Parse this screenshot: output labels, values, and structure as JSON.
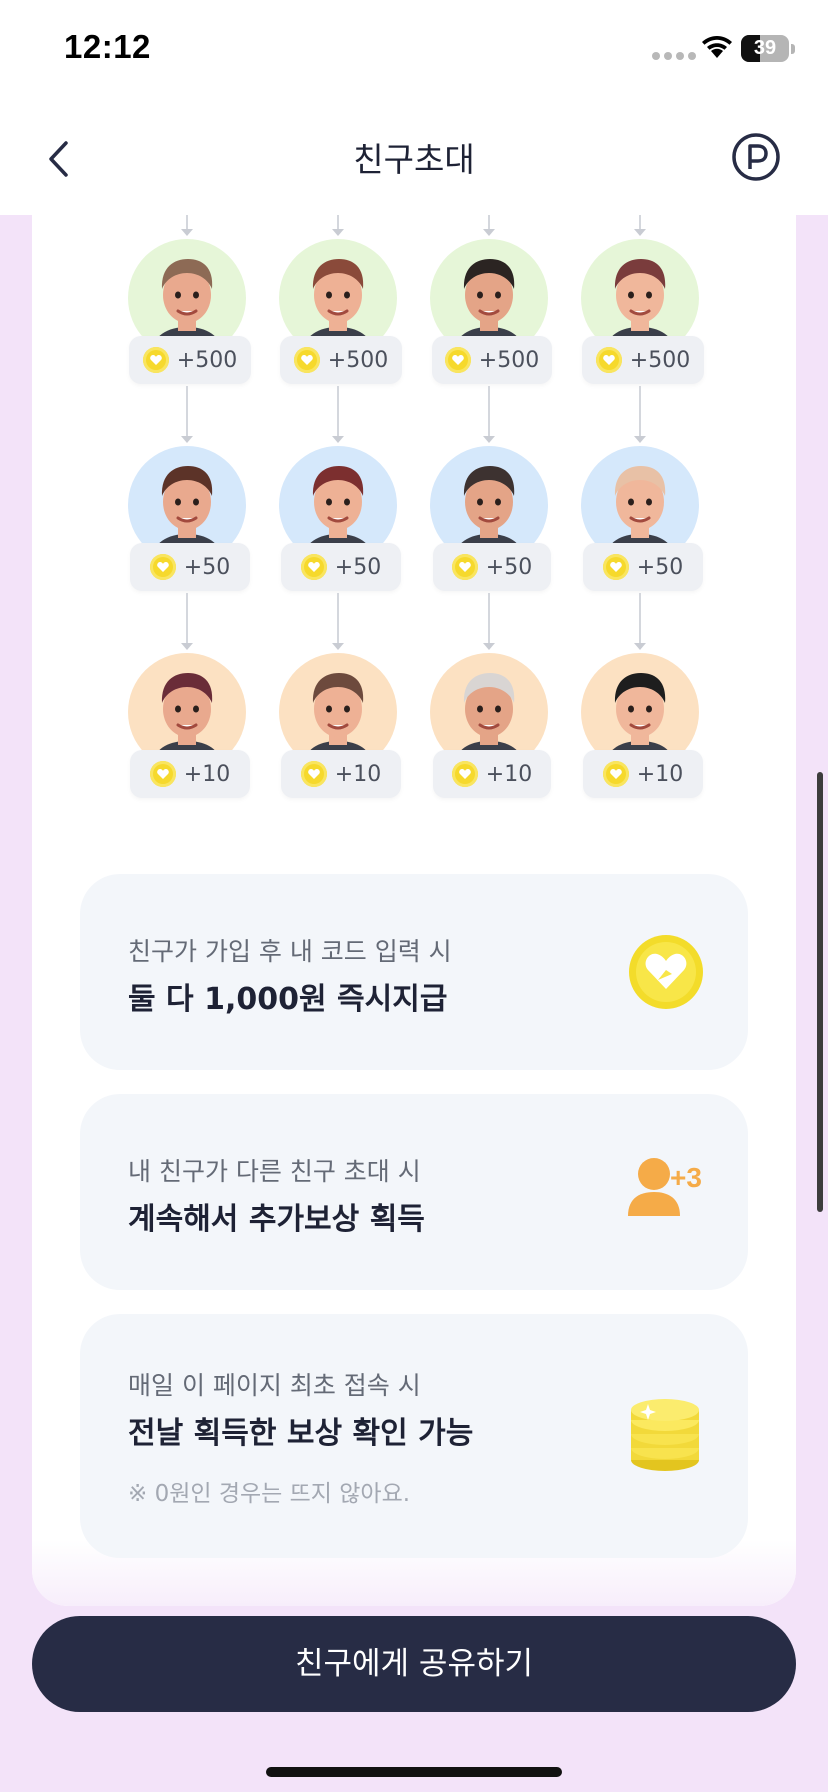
{
  "status_bar": {
    "time": "12:12",
    "battery_percent": 39,
    "battery_text": "39"
  },
  "nav": {
    "title": "친구초대",
    "back_icon": "chevron-left-icon",
    "point_icon": "point-circle-icon"
  },
  "tiers": [
    {
      "level": 1,
      "reward": "+500",
      "background": "#e6f6d8",
      "avatars": [
        "man-short-brown-hair",
        "woman-hair-bun",
        "man-dark-hair-goatee",
        "man-maroon-hair-earring"
      ]
    },
    {
      "level": 2,
      "reward": "+50",
      "background": "#d5e8fb",
      "avatars": [
        "man-long-hair-beard",
        "man-maroon-cap",
        "man-dark-side-part",
        "bald-man-mohawk"
      ]
    },
    {
      "level": 3,
      "reward": "+10",
      "background": "#fce1c2",
      "avatars": [
        "man-beanie-sunglasses",
        "man-glasses-mustache",
        "woman-grey-bun",
        "man-black-cap-beard"
      ]
    }
  ],
  "info_cards": [
    {
      "subtitle": "친구가 가입 후 내 코드 입력 시",
      "title": "둘 다 1,000원 즉시지급",
      "icon": "heart-coin-icon"
    },
    {
      "subtitle": "내 친구가 다른 친구 초대 시",
      "title": "계속해서 추가보상 획득",
      "icon": "user-plus-three-icon",
      "icon_text": "+3"
    },
    {
      "subtitle": "매일 이 페이지 최초 접속 시",
      "title": "전날 획득한 보상 확인 가능",
      "note": "※ 0원인 경우는 뜨지 않아요.",
      "icon": "coin-stack-icon"
    }
  ],
  "share_button": {
    "label": "친구에게 공유하기"
  },
  "colors": {
    "accent": "#272c45",
    "page_bg": "#f3e3f9",
    "coin": "#f6d92c",
    "orange": "#f5ab48"
  }
}
